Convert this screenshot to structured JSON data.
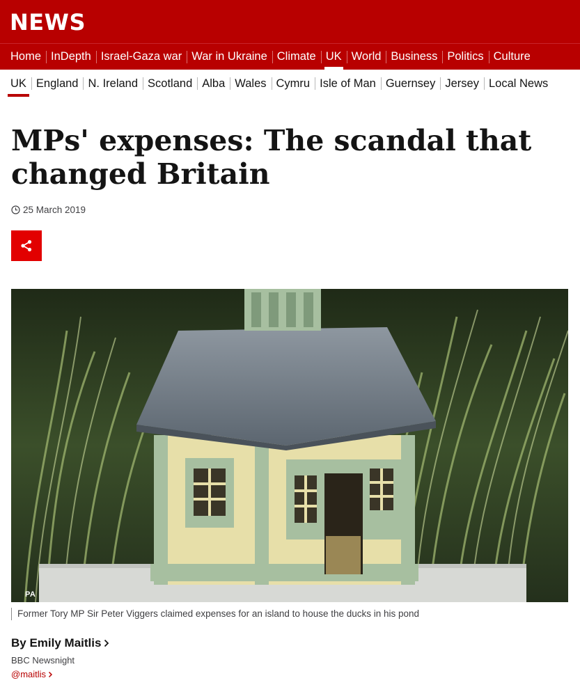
{
  "brand": {
    "logo_text": "NEWS",
    "color": "#b80000"
  },
  "top_nav": {
    "items": [
      "Home",
      "InDepth",
      "Israel-Gaza war",
      "War in Ukraine",
      "Climate",
      "UK",
      "World",
      "Business",
      "Politics",
      "Culture"
    ],
    "active": "UK"
  },
  "sub_nav": {
    "items": [
      "UK",
      "England",
      "N. Ireland",
      "Scotland",
      "Alba",
      "Wales",
      "Cymru",
      "Isle of Man",
      "Guernsey",
      "Jersey",
      "Local News"
    ],
    "active": "UK"
  },
  "article": {
    "headline": "MPs' expenses: The scandal that changed Britain",
    "date": "25 March 2019",
    "share_icon": "share-icon",
    "image": {
      "credit": "PA",
      "caption": "Former Tory MP Sir Peter Viggers claimed expenses for an island to house the ducks in his pond"
    },
    "byline": {
      "author": "By Emily Maitlis",
      "role": "BBC Newsnight",
      "handle": "@maitlis"
    }
  },
  "colors": {
    "accent": "#b80000",
    "share_button": "#e20000",
    "text": "#141414",
    "muted": "#3f3f42"
  }
}
